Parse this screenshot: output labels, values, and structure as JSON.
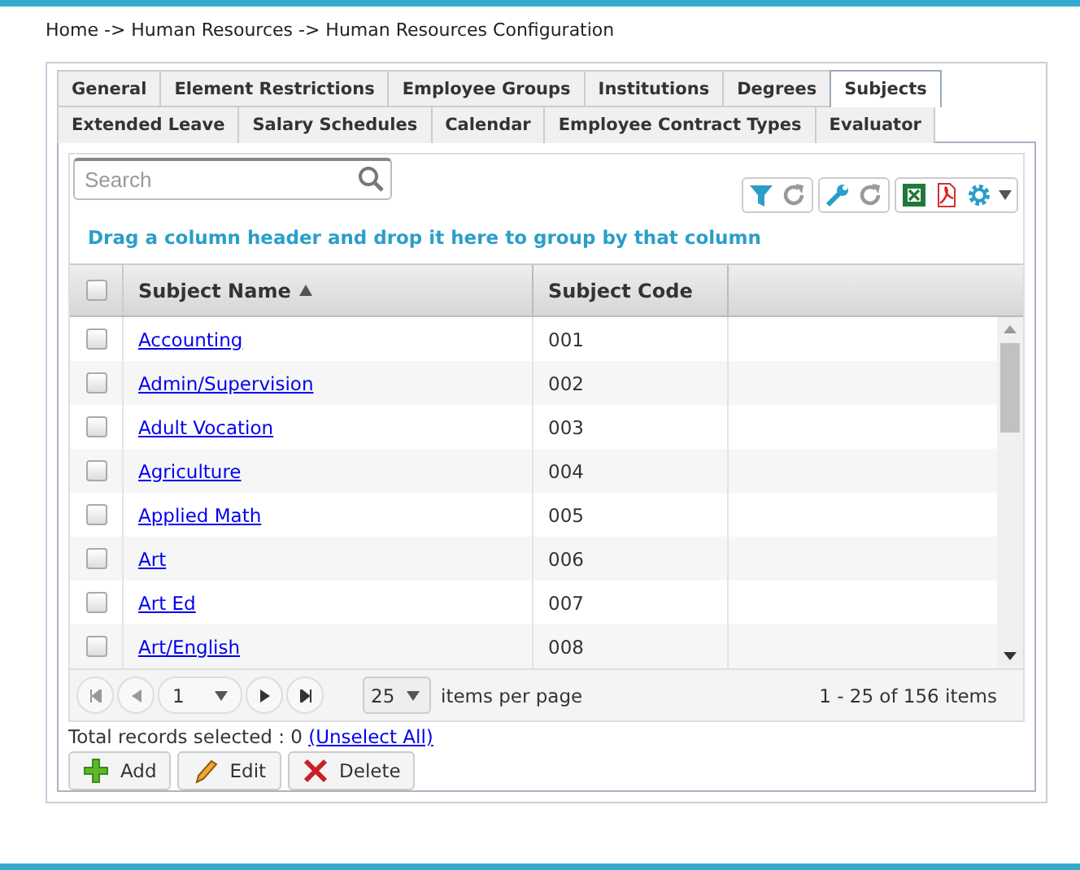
{
  "breadcrumb": "Home -> Human Resources -> Human Resources Configuration",
  "tab_rows": [
    [
      {
        "label": "General",
        "selected": false
      },
      {
        "label": "Element Restrictions",
        "selected": false
      },
      {
        "label": "Employee Groups",
        "selected": false
      },
      {
        "label": "Institutions",
        "selected": false
      },
      {
        "label": "Degrees",
        "selected": false
      },
      {
        "label": "Subjects",
        "selected": true
      }
    ],
    [
      {
        "label": "Extended Leave",
        "selected": false
      },
      {
        "label": "Salary Schedules",
        "selected": false
      },
      {
        "label": "Calendar",
        "selected": false
      },
      {
        "label": "Employee Contract Types",
        "selected": false
      },
      {
        "label": "Evaluator",
        "selected": false
      }
    ]
  ],
  "search": {
    "placeholder": "Search"
  },
  "group_hint": "Drag a column header and drop it here to group by that column",
  "table": {
    "select_all_checked": false,
    "columns": [
      {
        "label": "Subject Name",
        "sorted": true
      },
      {
        "label": "Subject Code",
        "sorted": false
      }
    ],
    "rows": [
      {
        "name": "Accounting",
        "code": "001",
        "checked": false
      },
      {
        "name": "Admin/Supervision",
        "code": "002",
        "checked": false
      },
      {
        "name": "Adult Vocation",
        "code": "003",
        "checked": false
      },
      {
        "name": "Agriculture",
        "code": "004",
        "checked": false
      },
      {
        "name": "Applied Math",
        "code": "005",
        "checked": false
      },
      {
        "name": "Art",
        "code": "006",
        "checked": false
      },
      {
        "name": "Art Ed",
        "code": "007",
        "checked": false
      },
      {
        "name": "Art/English",
        "code": "008",
        "checked": false
      }
    ]
  },
  "pager": {
    "page": "1",
    "page_size": "25",
    "page_size_label": "items per page",
    "summary": "1 - 25 of 156 items"
  },
  "selection": {
    "text": "Total records selected : 0",
    "link": "(Unselect All)"
  },
  "buttons": [
    {
      "label": "Add",
      "kind": "add"
    },
    {
      "label": "Edit",
      "kind": "edit"
    },
    {
      "label": "Delete",
      "kind": "delete"
    }
  ]
}
